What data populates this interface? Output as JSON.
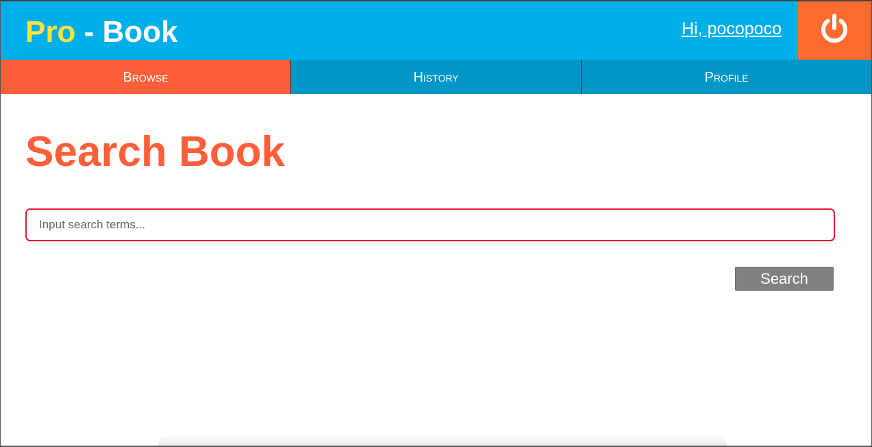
{
  "header": {
    "brand_pro": "Pro",
    "brand_rest": " - Book",
    "greeting": "Hi, pocopoco",
    "logout_icon": "power-icon",
    "colors": {
      "header_bg": "#00aeea",
      "brand_accent": "#ffe33d",
      "logout_bg": "#ff6a2f"
    }
  },
  "nav": {
    "tabs": [
      {
        "label": "Browse",
        "active": true
      },
      {
        "label": "History",
        "active": false
      },
      {
        "label": "Profile",
        "active": false
      }
    ],
    "colors": {
      "active": "#ff5e3a",
      "inactive": "#0096c7"
    }
  },
  "main": {
    "title": "Search Book",
    "search": {
      "placeholder": "Input search terms...",
      "value": ""
    },
    "search_button": "Search",
    "colors": {
      "title": "#ff5e3a",
      "input_border": "#e01b2e",
      "button_bg": "#818181"
    }
  }
}
